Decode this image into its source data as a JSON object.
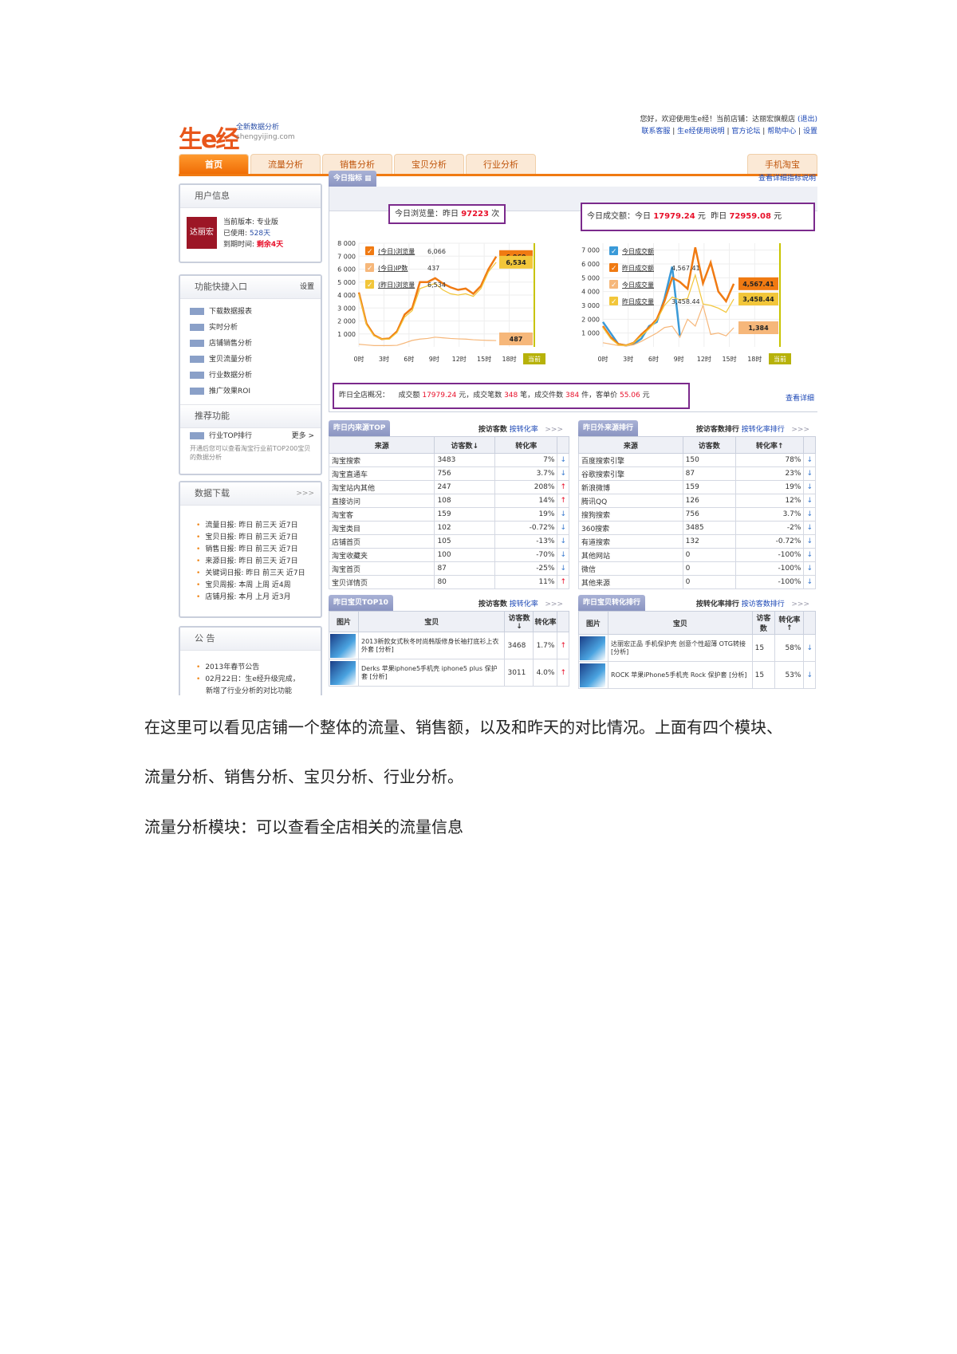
{
  "ui": {
    "logo": "生e经",
    "logo_sub1": "全新数据分析",
    "logo_sub2": "shengyijing.com",
    "top_line1": "您好，欢迎使用生e经！当前店铺：达丽宏旗舰店",
    "logout": "(退出)",
    "top_links": [
      "联系客服",
      "生e经使用说明",
      "官方论坛",
      "帮助中心",
      "设置"
    ],
    "tabs": [
      "首页",
      "流量分析",
      "销售分析",
      "宝贝分析",
      "行业分析"
    ],
    "mobile_tab": "手机淘宝",
    "user_box": {
      "title": "用户信息",
      "shop_logo": "达丽宏",
      "version_label": "当前版本:",
      "version": "专业版",
      "used_label": "已使用:",
      "used": "528天",
      "expire_label": "到期时间:",
      "expire": "剩余4天"
    },
    "func_box": {
      "title": "功能快捷入口",
      "edit": "设置",
      "items": [
        "下载数据报表",
        "实时分析",
        "店铺销售分析",
        "宝贝流量分析",
        "行业数据分析",
        "推广效果ROI"
      ],
      "rec_title": "推荐功能",
      "rec_item": "行业TOP排行",
      "rec_more": "更多 >",
      "rec_desc": "开通后您可以查看淘宝行业前TOP200宝贝的数据分析"
    },
    "download_box": {
      "title": "数据下载",
      "more": ">>>",
      "items": [
        "流量日报: 昨日 前三天 近7日",
        "宝贝日报: 昨日 前三天 近7日",
        "销售日报: 昨日 前三天 近7日",
        "来源日报: 昨日 前三天 近7日",
        "关键词日报: 昨日 前三天 近7日",
        "宝贝周报: 本周 上周 近4周",
        "店铺月报: 本月 上月 近3月"
      ]
    },
    "notice_box": {
      "title": "公 告",
      "items": [
        "2013年春节公告",
        "02月22日：生e经升级完成，",
        "新增了行业分析的对比功能"
      ]
    },
    "today": {
      "tab": "今日指标",
      "link": "查看详细指标说明",
      "pv_label": "今日浏览量：昨日",
      "pv_yesterday": "97223",
      "pv_unit": "次",
      "sales_label": "今日成交额：今日",
      "sales_today": "17979.24",
      "yuan": "元",
      "sales_y_label": "昨日",
      "sales_yesterday": "72959.08",
      "summary_label": "昨日全店概况：",
      "sum_amount_label": "成交额",
      "sum_amount": "17979.24",
      "sum_orders_label": "元，成交笔数",
      "sum_orders": "348",
      "sum_items_label": "笔，成交件数",
      "sum_items": "384",
      "sum_price_label": "件，客单价",
      "sum_price": "55.06",
      "sum_end": "元",
      "detail_link": "查看详细"
    }
  },
  "chart_data": [
    {
      "type": "line",
      "title": "今日流量",
      "x": [
        "0时",
        "3时",
        "6时",
        "9时",
        "12时",
        "15时",
        "18时",
        "当前"
      ],
      "ylim": [
        0,
        8000
      ],
      "yticks": [
        1000,
        2000,
        3000,
        4000,
        5000,
        6000,
        7000,
        8000
      ],
      "series": [
        {
          "name": "(今日)浏览量",
          "legend_value": "6,066",
          "callout": "6,969",
          "color": "#f07a12",
          "values": [
            4200,
            1800,
            900,
            600,
            650,
            1200,
            2500,
            3000,
            5000,
            5000,
            5300,
            4900,
            4600,
            4400,
            4500,
            4100,
            4700,
            6000,
            6969
          ]
        },
        {
          "name": "(今日)IP数",
          "legend_value": "437",
          "callout": "487",
          "color": "#f6b77a",
          "values": [
            200,
            150,
            100,
            100,
            100,
            120,
            300,
            500,
            600,
            650,
            750,
            700,
            650,
            620,
            600,
            550,
            520,
            500,
            487
          ]
        },
        {
          "name": "(昨日)浏览量",
          "legend_value": "6,534",
          "callout": "6,534",
          "color": "#f2c63a",
          "values": [
            4100,
            1700,
            850,
            600,
            600,
            1100,
            2300,
            2800,
            4500,
            4700,
            4900,
            4400,
            4100,
            4000,
            4100,
            3900,
            4500,
            5800,
            6534
          ]
        }
      ]
    },
    {
      "type": "line",
      "title": "今日销售",
      "x": [
        "0时",
        "3时",
        "6时",
        "9时",
        "12时",
        "15时",
        "18时",
        "当前"
      ],
      "ylim": [
        0,
        7500
      ],
      "yticks": [
        1000,
        2000,
        3000,
        4000,
        5000,
        6000,
        7000
      ],
      "series": [
        {
          "name": "今日成交额",
          "legend_value": "",
          "callout": "",
          "color": "#3a9ad8",
          "values": [
            1800,
            1000,
            200,
            100,
            200,
            600,
            1500,
            1800,
            3500,
            5800,
            800
          ]
        },
        {
          "name": "昨日成交额",
          "legend_value": "4,567.41",
          "callout": "4,567.41",
          "color": "#f07a12",
          "values": [
            1500,
            700,
            200,
            100,
            300,
            900,
            1400,
            2000,
            3300,
            5000,
            4700,
            4200,
            7200,
            4600,
            6100,
            4000,
            3300,
            4567
          ]
        },
        {
          "name": "今日成交量",
          "legend_value": "",
          "callout": "1,384",
          "color": "#f6b77a",
          "values": [
            300,
            200,
            100,
            80,
            150,
            400,
            700,
            1000,
            1400,
            1500,
            700,
            2000,
            1500,
            3000,
            900,
            1000,
            800,
            1384
          ]
        },
        {
          "name": "昨日成交量",
          "legend_value": "3,458.44",
          "callout": "3,458.44",
          "color": "#f2c63a",
          "values": [
            1400,
            600,
            150,
            100,
            300,
            800,
            1300,
            1900,
            3000,
            3600,
            3400,
            3500,
            5200,
            3100,
            3000,
            2800,
            2500,
            3458
          ]
        }
      ]
    }
  ],
  "tables": {
    "src_in": {
      "tab": "昨日内来源TOP",
      "sort1": "按访客数",
      "sort2": "按转化率",
      "more": ">>>",
      "cols": [
        "来源",
        "访客数↓",
        "转化率"
      ],
      "rows": [
        [
          "淘宝搜索",
          "3483",
          "7%",
          "↓"
        ],
        [
          "淘宝直通车",
          "756",
          "3.7%",
          "↓"
        ],
        [
          "淘宝站内其他",
          "247",
          "208%",
          "↑"
        ],
        [
          "直接访问",
          "108",
          "14%",
          "↑"
        ],
        [
          "淘宝客",
          "159",
          "19%",
          "↓"
        ],
        [
          "淘宝类目",
          "102",
          "-0.72%",
          "↓"
        ],
        [
          "店铺首页",
          "105",
          "-13%",
          "↓"
        ],
        [
          "淘宝收藏夹",
          "100",
          "-70%",
          "↓"
        ],
        [
          "淘宝首页",
          "87",
          "-25%",
          "↓"
        ],
        [
          "宝贝详情页",
          "80",
          "11%",
          "↑"
        ]
      ]
    },
    "src_out": {
      "tab": "昨日外来源排行",
      "sort1": "按访客数排行",
      "sort2": "按转化率排行",
      "more": ">>>",
      "cols": [
        "来源",
        "访客数",
        "转化率↑"
      ],
      "rows": [
        [
          "百度搜索引擎",
          "150",
          "78%",
          "↓"
        ],
        [
          "谷歌搜索引擎",
          "87",
          "23%",
          "↓"
        ],
        [
          "新浪微博",
          "159",
          "19%",
          "↓"
        ],
        [
          "腾讯QQ",
          "126",
          "12%",
          "↓"
        ],
        [
          "搜狗搜索",
          "756",
          "3.7%",
          "↓"
        ],
        [
          "360搜索",
          "3485",
          "-2%",
          "↓"
        ],
        [
          "有道搜索",
          "132",
          "-0.72%",
          "↓"
        ],
        [
          "其他网站",
          "0",
          "-100%",
          "↓"
        ],
        [
          "微信",
          "0",
          "-100%",
          "↓"
        ],
        [
          "其他来源",
          "0",
          "-100%",
          "↓"
        ]
      ]
    },
    "top_items": {
      "tab": "昨日宝贝TOP10",
      "sort1": "按访客数",
      "sort2": "按转化率",
      "more": ">>>",
      "cols": [
        "图片",
        "宝贝",
        "访客数↓",
        "转化率"
      ],
      "rows": [
        [
          "2013新款女式秋冬时尚韩版修身长袖打底衫上衣外套 [分析]",
          "3468",
          "1.7%",
          "↑"
        ],
        [
          "Derks 苹果iphone5手机壳 iphone5 plus 保护套 [分析]",
          "3011",
          "4.0%",
          "↑"
        ]
      ]
    },
    "conv_items": {
      "tab": "昨日宝贝转化排行",
      "sort1": "按转化率排行",
      "sort2": "按访客数排行",
      "more": ">>>",
      "cols": [
        "图片",
        "宝贝",
        "访客数",
        "转化率↑"
      ],
      "rows": [
        [
          "达丽宏正品 手机保护壳 创意个性超薄 OTG转接 [分析]",
          "15",
          "58%",
          "↓"
        ],
        [
          "ROCK 苹果iPhone5手机壳 Rock 保护套 [分析]",
          "15",
          "53%",
          "↓"
        ]
      ]
    }
  },
  "doc": {
    "line1": "在这里可以看见店铺一个整体的流量、销售额，以及和昨天的对比情况。上面有四个模块、",
    "line2": "流量分析、销售分析、宝贝分析、行业分析。",
    "line3": "流量分析模块：可以查看全店相关的流量信息"
  }
}
